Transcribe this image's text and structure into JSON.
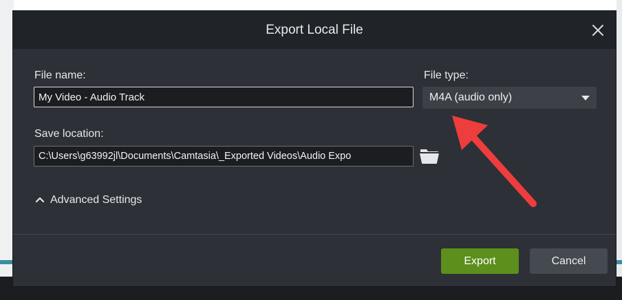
{
  "dialog": {
    "title": "Export Local File",
    "file_name": {
      "label": "File name:",
      "value": "My Video - Audio Track"
    },
    "file_type": {
      "label": "File type:",
      "selected": "M4A (audio only)"
    },
    "save_location": {
      "label": "Save location:",
      "value": "C:\\Users\\g63992jl\\Documents\\Camtasia\\_Exported Videos\\Audio Expo"
    },
    "advanced_settings_label": "Advanced Settings",
    "export_label": "Export",
    "cancel_label": "Cancel"
  },
  "icons": {
    "close": "close-icon",
    "folder": "folder-icon",
    "chevron": "chevron-up-icon",
    "dropdown": "chevron-down-icon",
    "annotation": "red-arrow"
  },
  "colors": {
    "dialog_bg": "#2d3036",
    "titlebar_bg": "#202327",
    "export_button": "#5c8f1b",
    "cancel_button": "#454950",
    "annotation_arrow": "#ee3d3d"
  }
}
